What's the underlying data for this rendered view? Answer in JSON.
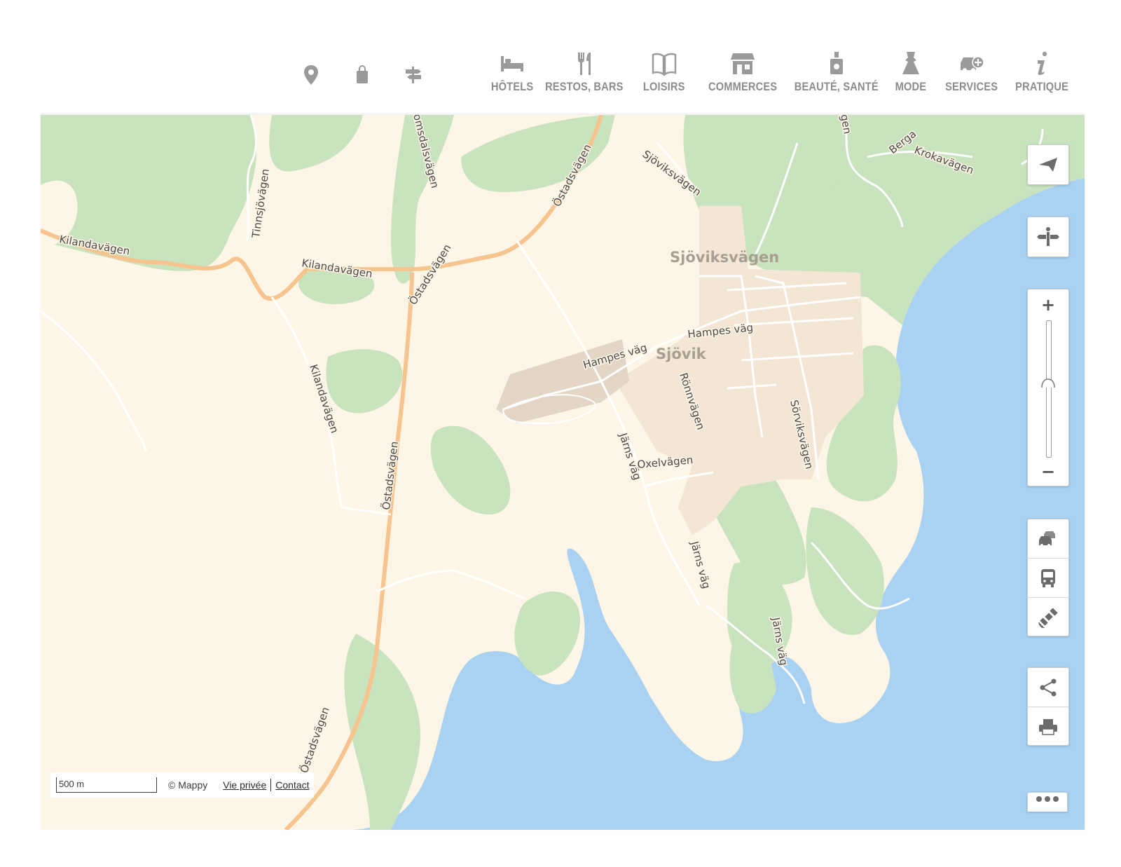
{
  "nav": {
    "quick_icons": [
      {
        "name": "location-pin-icon"
      },
      {
        "name": "shopping-bag-icon"
      },
      {
        "name": "signpost-icon"
      }
    ],
    "categories": [
      {
        "label": "HÔTELS",
        "icon": "bed-icon"
      },
      {
        "label": "RESTOS, BARS",
        "icon": "fork-knife-icon"
      },
      {
        "label": "LOISIRS",
        "icon": "open-book-icon"
      },
      {
        "label": "COMMERCES",
        "icon": "shop-icon"
      },
      {
        "label": "BEAUTÉ, SANTÉ",
        "icon": "perfume-bottle-icon"
      },
      {
        "label": "MODE",
        "icon": "dress-icon"
      },
      {
        "label": "SERVICES",
        "icon": "car-plus-icon"
      },
      {
        "label": "PRATIQUE",
        "icon": "info-icon"
      }
    ],
    "label_color": "#8c8c8c"
  },
  "map": {
    "colors": {
      "land": "#fdf5e6",
      "forest": "#c9e3bf",
      "water": "#a8d1f2",
      "urban": "#f4e6d4",
      "urban_dark": "#e3d6c6",
      "main_road": "#f6c48e",
      "minor_road": "#ffffff"
    },
    "places": [
      {
        "label": "Sjöviksvägen"
      },
      {
        "label": "Sjövik"
      }
    ],
    "roads": [
      {
        "label": "Kilandavägen"
      },
      {
        "label": "Kilandavägen"
      },
      {
        "label": "Tinnsjövägen"
      },
      {
        "label": "Östadsvägen"
      },
      {
        "label": "Östadsvägen"
      },
      {
        "label": "Östadsvägen"
      },
      {
        "label": "Östadsvägen"
      },
      {
        "label": "Kilandavägen"
      },
      {
        "label": "Sjöviksvägen"
      },
      {
        "label": "Berga"
      },
      {
        "label": "Krokavägen"
      },
      {
        "label": "Hampes väg"
      },
      {
        "label": "Hampes väg"
      },
      {
        "label": "Rönnvägen"
      },
      {
        "label": "Järns väg"
      },
      {
        "label": "Oxelvägen"
      },
      {
        "label": "Sörviksvägen"
      },
      {
        "label": "Järns väg"
      },
      {
        "label": "Järns väg"
      },
      {
        "label": "omsdalsvägen"
      },
      {
        "label": "gen"
      }
    ]
  },
  "controls": {
    "locate": {
      "icon": "navigation-arrow-icon"
    },
    "directions": {
      "icon": "directions-signpost-icon"
    },
    "zoom_in": "+",
    "zoom_out": "−",
    "zoom_level": 0.46,
    "layers": [
      {
        "icon": "traffic-cars-icon"
      },
      {
        "icon": "public-transport-bus-icon"
      },
      {
        "icon": "satellite-icon"
      }
    ],
    "share": {
      "icon": "share-icon"
    },
    "print": {
      "icon": "printer-icon"
    },
    "more": {
      "icon": "more-dots-icon"
    }
  },
  "footer": {
    "scale_label": "500 m",
    "copyright": "© Mappy",
    "privacy_link": "Vie privée",
    "contact_link": "Contact"
  }
}
